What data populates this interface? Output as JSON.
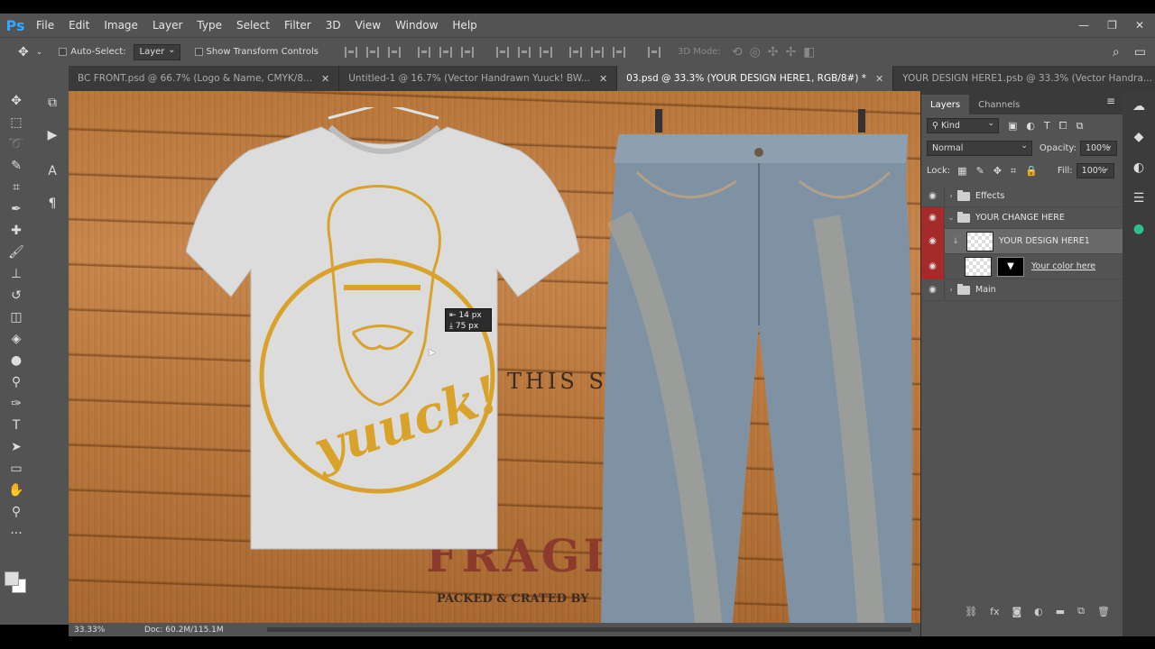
{
  "app": {
    "logo": "Ps"
  },
  "menu": [
    "File",
    "Edit",
    "Image",
    "Layer",
    "Type",
    "Select",
    "Filter",
    "3D",
    "View",
    "Window",
    "Help"
  ],
  "options": {
    "auto_select": "Auto-Select:",
    "auto_select_value": "Layer",
    "show_transform": "Show Transform Controls",
    "mode_3d": "3D Mode:"
  },
  "tabs": [
    {
      "label": "BC FRONT.psd @ 66.7% (Logo & Name, CMYK/8...",
      "active": false
    },
    {
      "label": "Untitled-1 @ 16.7% (Vector Handrawn Yuuck!  BW...",
      "active": false
    },
    {
      "label": "03.psd @ 33.3% (YOUR DESIGN HERE1, RGB/8#) *",
      "active": true
    },
    {
      "label": "YOUR DESIGN HERE1.psb @ 33.3% (Vector Handra...",
      "active": false
    }
  ],
  "canvas": {
    "shirt_print": "yuuck!",
    "crate_line1": "THIS SI",
    "crate_line2": "FRAGIL",
    "crate_line3": "PACKED & CRATED BY",
    "tooltip_x": "14 px",
    "tooltip_y": "75 px"
  },
  "status": {
    "zoom": "33.33%",
    "doc": "Doc: 60.2M/115.1M"
  },
  "layers_panel": {
    "tab_layers": "Layers",
    "tab_channels": "Channels",
    "filter_kind": "Kind",
    "blend_mode": "Normal",
    "opacity_label": "Opacity:",
    "opacity_value": "100%",
    "lock_label": "Lock:",
    "fill_label": "Fill:",
    "fill_value": "100%",
    "layers": [
      {
        "name": "Effects",
        "type": "group",
        "collapsed": true,
        "visible_highlight": false
      },
      {
        "name": "YOUR CHANGE HERE",
        "type": "group",
        "collapsed": false,
        "visible_highlight": true
      },
      {
        "name": "YOUR DESIGN HERE1",
        "type": "smart",
        "selected": true,
        "visible_highlight": true
      },
      {
        "name": "Your color here",
        "type": "masked",
        "visible_highlight": true
      },
      {
        "name": "Main",
        "type": "group",
        "collapsed": true,
        "visible_highlight": false
      }
    ]
  }
}
